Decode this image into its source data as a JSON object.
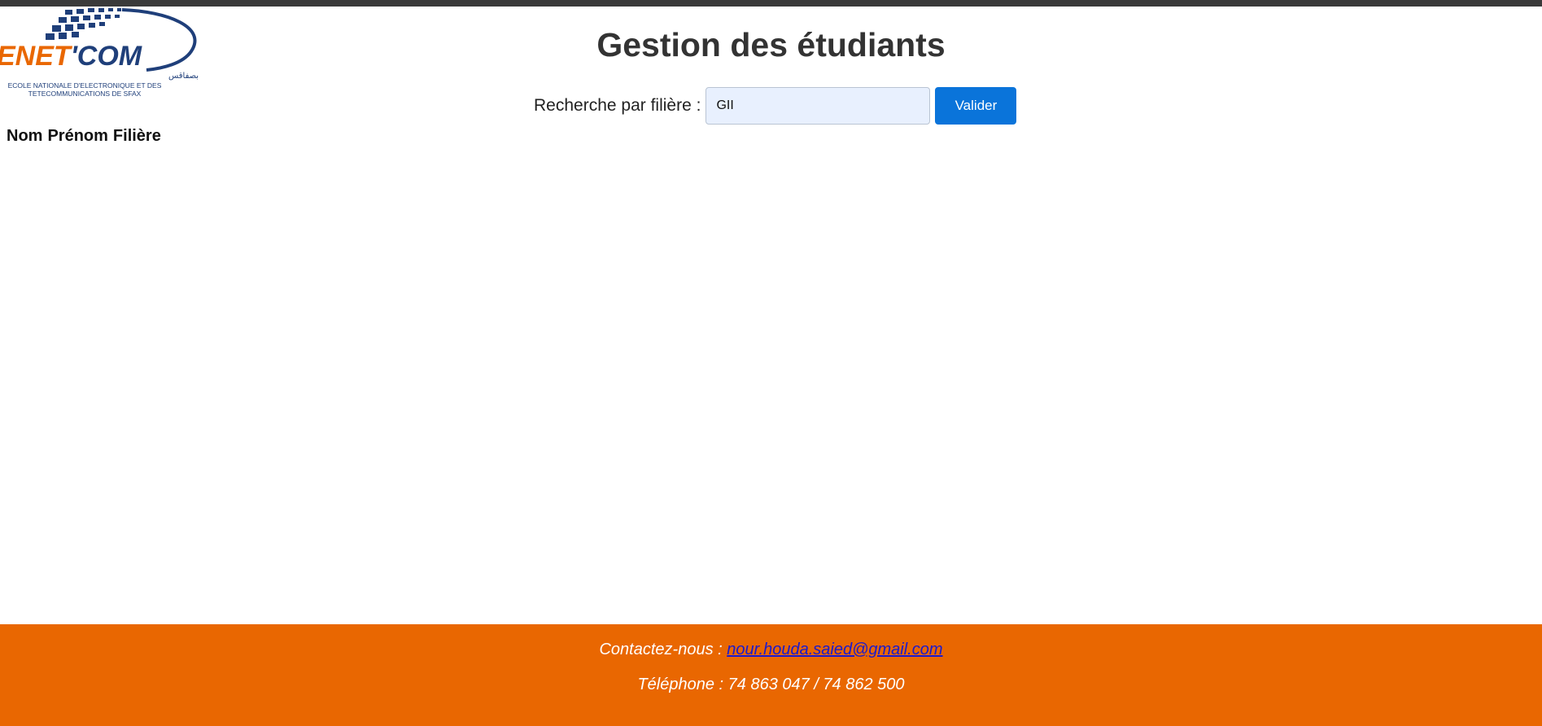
{
  "logo": {
    "wordmark": "ENET'COM",
    "arabic_text": "المدرسة الوطنية للالكترونيك والاتصالات بصفاقس",
    "line1": "ECOLE NATIONALE D'ELECTRONIQUE ET DES",
    "line2": "TETECOMMUNICATIONS DE SFAX",
    "colors": {
      "blue": "#1f3f7a",
      "orange": "#e96701"
    }
  },
  "page_title": "Gestion des étudiants",
  "search": {
    "label": "Recherche par filière :",
    "value": "GII",
    "button_label": "Valider"
  },
  "table": {
    "headers": [
      "Nom",
      "Prénom",
      "Filière"
    ],
    "rows": []
  },
  "footer": {
    "contact_label": "Contactez-nous :",
    "email": "nour.houda.saied@gmail.com",
    "phone": "Téléphone : 74 863 047 / 74 862 500",
    "background_color": "#e96701"
  }
}
